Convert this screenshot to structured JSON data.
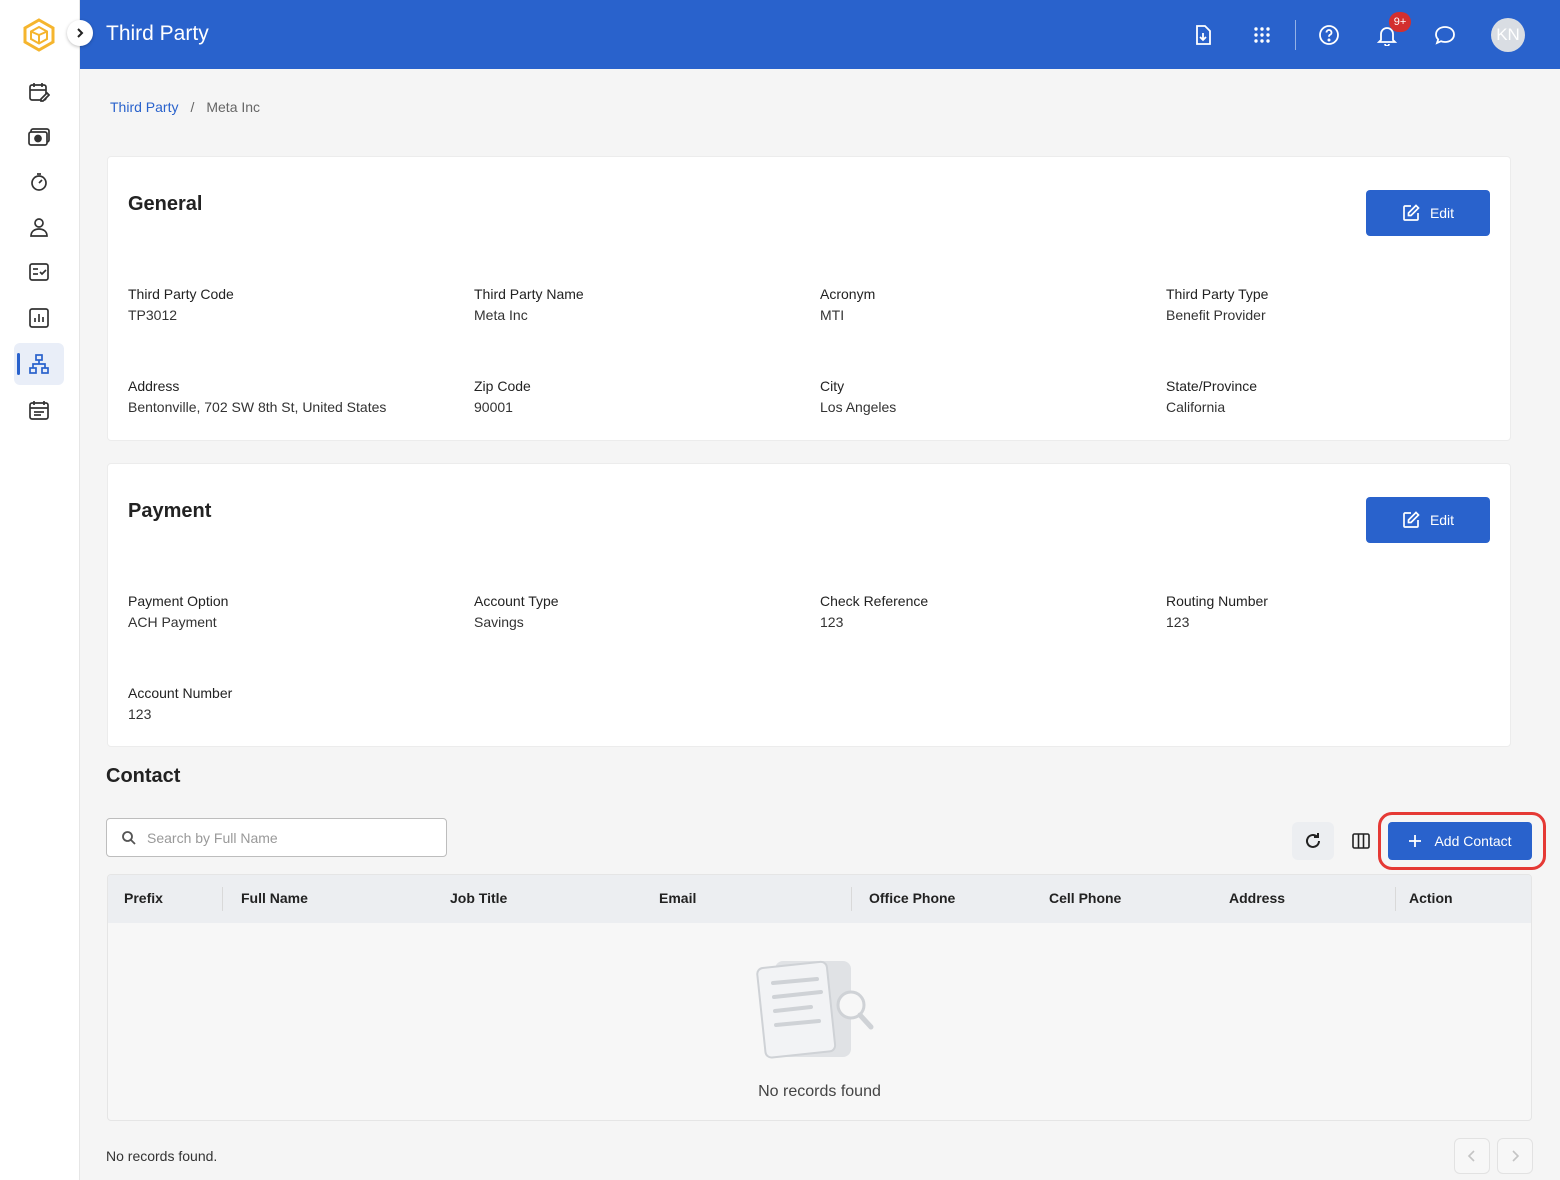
{
  "app": {
    "avatar_initials": "KN",
    "notification_count": "9+"
  },
  "header": {
    "title": "Third Party"
  },
  "sidebar": {
    "items": [
      {
        "name": "calendar-edit"
      },
      {
        "name": "payroll"
      },
      {
        "name": "timer"
      },
      {
        "name": "person"
      },
      {
        "name": "checklist"
      },
      {
        "name": "reports"
      },
      {
        "name": "org-chart",
        "active": true
      },
      {
        "name": "schedule"
      }
    ]
  },
  "breadcrumb": {
    "root": "Third Party",
    "separator": "/",
    "current": "Meta Inc"
  },
  "general": {
    "title": "General",
    "edit_label": "Edit",
    "fields": [
      {
        "label": "Third Party Code",
        "value": "TP3012"
      },
      {
        "label": "Third Party Name",
        "value": "Meta Inc"
      },
      {
        "label": "Acronym",
        "value": "MTI"
      },
      {
        "label": "Third Party Type",
        "value": "Benefit Provider"
      },
      {
        "label": "Address",
        "value": "Bentonville, 702 SW 8th St, United States"
      },
      {
        "label": "Zip Code",
        "value": "90001"
      },
      {
        "label": "City",
        "value": "Los Angeles"
      },
      {
        "label": "State/Province",
        "value": "California"
      }
    ]
  },
  "payment": {
    "title": "Payment",
    "edit_label": "Edit",
    "fields": [
      {
        "label": "Payment Option",
        "value": "ACH Payment"
      },
      {
        "label": "Account Type",
        "value": "Savings"
      },
      {
        "label": "Check Reference",
        "value": "123"
      },
      {
        "label": "Routing Number",
        "value": "123"
      },
      {
        "label": "Account Number",
        "value": "123"
      }
    ]
  },
  "contact": {
    "title": "Contact",
    "search_placeholder": "Search by Full Name",
    "add_label": "Add Contact",
    "columns": [
      "Prefix",
      "Full Name",
      "Job Title",
      "Email",
      "Office Phone",
      "Cell Phone",
      "Address",
      "Action"
    ],
    "empty_text": "No records found",
    "footer_text": "No records found."
  },
  "colors": {
    "primary": "#2962cc",
    "highlight": "#e53935",
    "badge": "#d32f2f",
    "logo": "#f5b52e"
  }
}
